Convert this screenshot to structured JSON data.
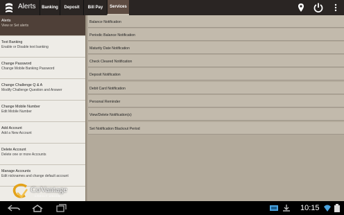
{
  "app": {
    "title": "Alerts"
  },
  "tabs": [
    {
      "label": "Banking"
    },
    {
      "label": "Deposit"
    },
    {
      "label": "Bill Pay"
    },
    {
      "label": "Services"
    }
  ],
  "toolbar_icons": [
    "location-pin-icon",
    "power-icon",
    "overflow-menu-icon"
  ],
  "sidebar": {
    "items": [
      {
        "title": "Alerts",
        "subtitle": "View or Set alerts"
      },
      {
        "title": "Text Banking",
        "subtitle": "Enable or Disable text banking"
      },
      {
        "title": "Change Password",
        "subtitle": "Change Mobile Banking Password"
      },
      {
        "title": "Change Challenge Q & A",
        "subtitle": "Modify Challenge Question and Answer"
      },
      {
        "title": "Change Mobile Number",
        "subtitle": "Edit Mobile Number"
      },
      {
        "title": "Add Account",
        "subtitle": "Add a New Account"
      },
      {
        "title": "Delete Account",
        "subtitle": "Delete one or more Accounts"
      },
      {
        "title": "Manage Accounts",
        "subtitle": "Edit nicknames and change default account"
      }
    ]
  },
  "logo": {
    "name": "CoVantage",
    "tagline": "CREDIT UNION"
  },
  "notifications": [
    {
      "label": "Balance Notification"
    },
    {
      "label": "Periodic Balance Notification"
    },
    {
      "label": "Maturity Date Notification"
    },
    {
      "label": "Check Cleared Notification"
    },
    {
      "label": "Deposit Notification"
    },
    {
      "label": "Debit Card Notification"
    },
    {
      "label": "Personal Reminder"
    },
    {
      "label": "View/Delete Notification(s)"
    },
    {
      "label": "Set Notification Blackout Period"
    }
  ],
  "status": {
    "time": "10:15"
  },
  "colors": {
    "topbar": "#2a2523",
    "active_tab": "#5e4c42",
    "selected_item": "#4f4038",
    "notification_row": "#c2baac"
  }
}
